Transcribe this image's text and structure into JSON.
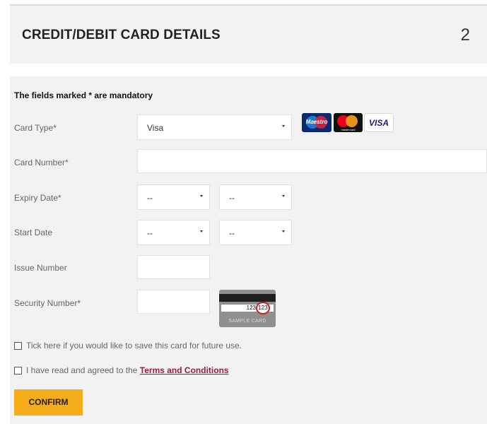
{
  "header": {
    "title": "CREDIT/DEBIT CARD DETAILS",
    "step": "2"
  },
  "form": {
    "mandatory_note": "The fields marked * are mandatory",
    "card_type": {
      "label": "Card Type*",
      "value": "Visa"
    },
    "card_number": {
      "label": "Card Number*",
      "value": ""
    },
    "expiry_date": {
      "label": "Expiry Date*",
      "month": "--",
      "year": "--"
    },
    "start_date": {
      "label": "Start Date",
      "month": "--",
      "year": "--"
    },
    "issue_number": {
      "label": "Issue Number",
      "value": ""
    },
    "security_number": {
      "label": "Security Number*",
      "value": ""
    }
  },
  "card_logos": [
    {
      "name": "Maestro",
      "text": "Maestro"
    },
    {
      "name": "Mastercard",
      "text": "mastercard"
    },
    {
      "name": "Visa",
      "text": "VISA"
    }
  ],
  "sample_card": {
    "digits": "123",
    "highlighted": "123",
    "caption": "SAMPLE CARD"
  },
  "save_card": {
    "label": "Tick here if you would like to save this card for future use.",
    "checked": false
  },
  "terms": {
    "prefix": "I have read and agreed to the ",
    "link": "Terms and Conditions",
    "checked": false
  },
  "confirm_label": "CONFIRM",
  "colors": {
    "accent": "#f5ae1a",
    "link": "#9b1b3a",
    "panel": "#f2f2f2"
  },
  "icons": [
    "chevron-down-icon",
    "checkbox-icon"
  ]
}
